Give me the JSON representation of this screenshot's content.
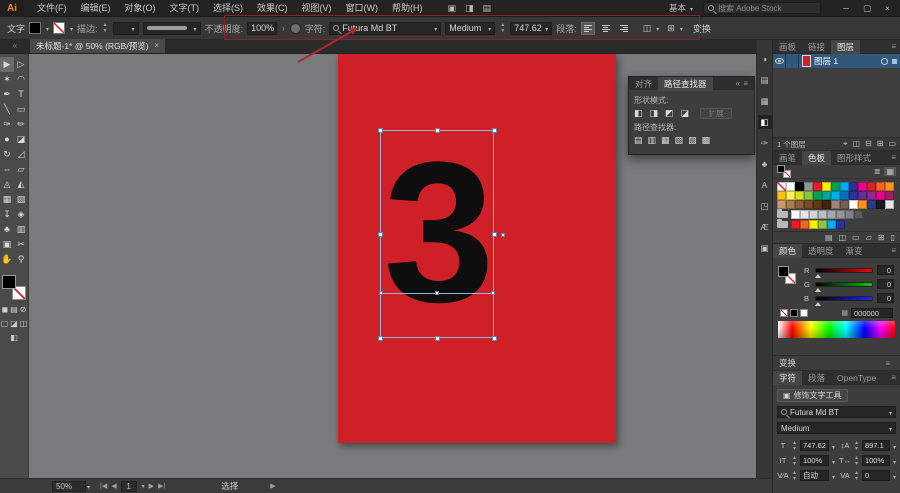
{
  "app": {
    "logo": "Ai",
    "workspace": "基本",
    "search_placeholder": "搜索 Adobe Stock",
    "window": {
      "min": "─",
      "max": "▢",
      "close": "×"
    }
  },
  "menu": {
    "items": [
      {
        "label": "文件(F)",
        "name": "menu-file"
      },
      {
        "label": "编辑(E)",
        "name": "menu-edit"
      },
      {
        "label": "对象(O)",
        "name": "menu-object"
      },
      {
        "label": "文字(T)",
        "name": "menu-type"
      },
      {
        "label": "选择(S)",
        "name": "menu-select"
      },
      {
        "label": "效果(C)",
        "name": "menu-effect"
      },
      {
        "label": "视图(V)",
        "name": "menu-view"
      },
      {
        "label": "窗口(W)",
        "name": "menu-window"
      },
      {
        "label": "帮助(H)",
        "name": "menu-help"
      }
    ]
  },
  "titlebar_icons": [
    {
      "name": "bridge-icon",
      "glyph": "▣"
    },
    {
      "name": "gpu-performance-icon",
      "glyph": "◨"
    },
    {
      "name": "arrange-documents-icon",
      "glyph": "▤"
    }
  ],
  "control": {
    "object_label": "文字",
    "stroke_label": "描边:",
    "opacity_label": "不透明度:",
    "opacity_value": "100%",
    "opacity_more": "›",
    "char_label": "字符:",
    "font_name": "Futura Md BT",
    "font_style": "Medium",
    "font_size": "747.62",
    "para_label": "段落:",
    "align_flyout_icon": "◫",
    "transform_grid_icon": "⊞",
    "transform_label": "变换"
  },
  "doc_tab": {
    "title": "未标题-1* @ 50% (RGB/预览)",
    "close": "×"
  },
  "tools": [
    {
      "name": "selection-tool",
      "glyph": "▶",
      "active": true
    },
    {
      "name": "direct-selection-tool",
      "glyph": "▷"
    },
    {
      "name": "magic-wand-tool",
      "glyph": "✶"
    },
    {
      "name": "lasso-tool",
      "glyph": "◠"
    },
    {
      "name": "pen-tool",
      "glyph": "✒"
    },
    {
      "name": "type-tool",
      "glyph": "T"
    },
    {
      "name": "line-segment-tool",
      "glyph": "╲"
    },
    {
      "name": "rectangle-tool",
      "glyph": "▭"
    },
    {
      "name": "paintbrush-tool",
      "glyph": "✑"
    },
    {
      "name": "pencil-tool",
      "glyph": "✏"
    },
    {
      "name": "blob-brush-tool",
      "glyph": "●"
    },
    {
      "name": "eraser-tool",
      "glyph": "◪"
    },
    {
      "name": "rotate-tool",
      "glyph": "↻"
    },
    {
      "name": "scale-tool",
      "glyph": "◿"
    },
    {
      "name": "width-tool",
      "glyph": "⇔"
    },
    {
      "name": "free-transform-tool",
      "glyph": "▱"
    },
    {
      "name": "shape-builder-tool",
      "glyph": "◬"
    },
    {
      "name": "perspective-grid-tool",
      "glyph": "◭"
    },
    {
      "name": "mesh-tool",
      "glyph": "▦"
    },
    {
      "name": "gradient-tool",
      "glyph": "▧"
    },
    {
      "name": "eyedropper-tool",
      "glyph": "↧"
    },
    {
      "name": "blend-tool",
      "glyph": "◈"
    },
    {
      "name": "symbol-sprayer-tool",
      "glyph": "♣"
    },
    {
      "name": "column-graph-tool",
      "glyph": "▥"
    },
    {
      "name": "artboard-tool",
      "glyph": "▣"
    },
    {
      "name": "slice-tool",
      "glyph": "✂"
    },
    {
      "name": "hand-tool",
      "glyph": "✋"
    },
    {
      "name": "zoom-tool",
      "glyph": "⚲"
    }
  ],
  "toolbar_extras": {
    "color_modes": [
      {
        "name": "color-mode-icon",
        "glyph": "◼"
      },
      {
        "name": "gradient-mode-icon",
        "glyph": "▤"
      },
      {
        "name": "none-mode-icon",
        "glyph": "⊘"
      }
    ],
    "draw_modes": [
      {
        "name": "draw-normal-icon",
        "glyph": "▢"
      },
      {
        "name": "draw-behind-icon",
        "glyph": "◪"
      },
      {
        "name": "draw-inside-icon",
        "glyph": "◫"
      }
    ],
    "screen_mode_glyph": "◧"
  },
  "canvas": {
    "glyph": "3",
    "artboard_color": "#d02027"
  },
  "annotation": {
    "color": "#b3282d"
  },
  "pathfinder": {
    "tabs": [
      {
        "label": "对齐",
        "name": "tab-align"
      },
      {
        "label": "路径查找器",
        "name": "tab-pathfinder",
        "active": true
      }
    ],
    "collapse_icon": "«",
    "shape_modes_label": "形状模式:",
    "shape_mode_icons": [
      {
        "name": "unite-icon",
        "glyph": "◧"
      },
      {
        "name": "minus-front-icon",
        "glyph": "◨"
      },
      {
        "name": "intersect-icon",
        "glyph": "◩"
      },
      {
        "name": "exclude-icon",
        "glyph": "◪"
      }
    ],
    "expand_label": "扩展",
    "pathfinders_label": "路径查找器:",
    "pathfinder_icons": [
      {
        "name": "divide-icon",
        "glyph": "▤"
      },
      {
        "name": "trim-icon",
        "glyph": "▥"
      },
      {
        "name": "merge-icon",
        "glyph": "▦"
      },
      {
        "name": "crop-icon",
        "glyph": "▧"
      },
      {
        "name": "outline-icon",
        "glyph": "▨"
      },
      {
        "name": "minus-back-icon",
        "glyph": "▩"
      }
    ]
  },
  "dock_icons": [
    {
      "name": "color-panel-icon",
      "glyph": "◑"
    },
    {
      "name": "color-guide-icon",
      "glyph": "▤"
    },
    {
      "name": "swatches-panel-icon",
      "glyph": "▦"
    },
    {
      "name": "pathfinder-panel-icon",
      "glyph": "◧",
      "active": true
    },
    {
      "name": "brushes-panel-icon",
      "glyph": "✑"
    },
    {
      "name": "symbols-panel-icon",
      "glyph": "♣"
    },
    {
      "name": "character-styles-icon",
      "glyph": "A"
    },
    {
      "name": "graphic-styles-icon",
      "glyph": "◳"
    },
    {
      "name": "glyphs-panel-icon",
      "glyph": "Æ"
    },
    {
      "name": "artboards-panel-icon",
      "glyph": "▣"
    }
  ],
  "layers": {
    "tabs": [
      {
        "label": "画板",
        "name": "tab-artboards"
      },
      {
        "label": "链接",
        "name": "tab-links"
      },
      {
        "label": "图层",
        "name": "tab-layers",
        "active": true
      }
    ],
    "layer_name": "图层 1",
    "count": "1 个图层",
    "bottom_icons": [
      {
        "name": "locate-object-icon",
        "glyph": "⌖"
      },
      {
        "name": "make-clipping-mask-icon",
        "glyph": "◫"
      },
      {
        "name": "new-sublayer-icon",
        "glyph": "⊟"
      },
      {
        "name": "new-layer-icon",
        "glyph": "⊞"
      },
      {
        "name": "delete-layer-icon",
        "glyph": "▭"
      }
    ]
  },
  "swatches": {
    "tabs": [
      {
        "label": "画笔",
        "name": "tab-brushes"
      },
      {
        "label": "色板",
        "name": "tab-swatches",
        "active": true
      },
      {
        "label": "图形样式",
        "name": "tab-graphic-styles"
      }
    ],
    "view_icons": [
      {
        "name": "list-view-icon",
        "glyph": "≣"
      },
      {
        "name": "grid-view-icon",
        "glyph": "▦",
        "active": true
      }
    ],
    "row1": [
      "none",
      "#ffffff",
      "#000000",
      "#939598",
      "#ed1c24",
      "#fff200",
      "#00a651",
      "#00aeef",
      "#2e3192",
      "#ec008c",
      "#d2232a",
      "#f26522",
      "#f7941d"
    ],
    "row2": [
      "#ffc20e",
      "#fff45c",
      "#d7df23",
      "#8dc63f",
      "#00a651",
      "#00a99d",
      "#00aeef",
      "#0072bc",
      "#2e3192",
      "#662d91",
      "#92278f",
      "#ec008c",
      "#9e1f63"
    ],
    "row3": [
      "#c49a6c",
      "#a97c50",
      "#8b5e3c",
      "#754c29",
      "#603913",
      "#3c2415",
      "#998675",
      "#736357",
      "#ffffff",
      "#f7941d",
      "#2b3990",
      "#1a1a1a",
      "#e6e7e8"
    ],
    "group_grays": [
      "#ffffff",
      "#e6e7e8",
      "#d1d3d4",
      "#bcbec0",
      "#a7a9ac",
      "#939598",
      "#808285",
      "#58595b"
    ],
    "group_brights": [
      "#ed1c24",
      "#f26522",
      "#fff200",
      "#8dc63f",
      "#00aeef",
      "#2e3192"
    ],
    "bottom_icons": [
      {
        "name": "swatch-libraries-icon",
        "glyph": "▤"
      },
      {
        "name": "swatch-kinds-icon",
        "glyph": "◫"
      },
      {
        "name": "swatch-options-icon",
        "glyph": "▭"
      },
      {
        "name": "new-color-group-icon",
        "glyph": "▱"
      },
      {
        "name": "new-swatch-icon",
        "glyph": "⊞"
      },
      {
        "name": "delete-swatch-icon",
        "glyph": "▯"
      }
    ]
  },
  "color": {
    "tabs": [
      {
        "label": "颜色",
        "name": "tab-color",
        "active": true
      },
      {
        "label": "透明度",
        "name": "tab-transparency"
      },
      {
        "label": "渐变",
        "name": "tab-gradient"
      }
    ],
    "sliders": [
      {
        "label": "R",
        "value": "0",
        "color": "#ff0000"
      },
      {
        "label": "G",
        "value": "0",
        "color": "#00cc00"
      },
      {
        "label": "B",
        "value": "0",
        "color": "#2222ff"
      }
    ],
    "hex": "000000"
  },
  "transform": {
    "label": "变换"
  },
  "character": {
    "tabs": [
      {
        "label": "字符",
        "name": "tab-character",
        "active": true
      },
      {
        "label": "段落",
        "name": "tab-paragraph"
      },
      {
        "label": "OpenType",
        "name": "tab-opentype"
      }
    ],
    "touch_icon": "▣",
    "touch_label": "修饰文字工具",
    "font_name": "Futura Md BT",
    "font_style": "Medium",
    "fields": [
      {
        "name": "font-size-field",
        "icon": "T",
        "value": "747.62"
      },
      {
        "name": "leading-field",
        "icon": "↕A",
        "value": "897.1"
      },
      {
        "name": "vertical-scale-field",
        "icon": "IT",
        "value": "100%"
      },
      {
        "name": "horizontal-scale-field",
        "icon": "T↔",
        "value": "100%"
      },
      {
        "name": "kerning-field",
        "icon": "V⁄A",
        "value": "自动"
      },
      {
        "name": "tracking-field",
        "icon": "VA",
        "value": "0"
      }
    ]
  },
  "status": {
    "zoom": "50%",
    "nav_first": "|◀",
    "nav_prev": "◀",
    "artboard": "1",
    "nav_next": "▶",
    "nav_last": "▶|",
    "tool": "选择",
    "more": "▶"
  }
}
